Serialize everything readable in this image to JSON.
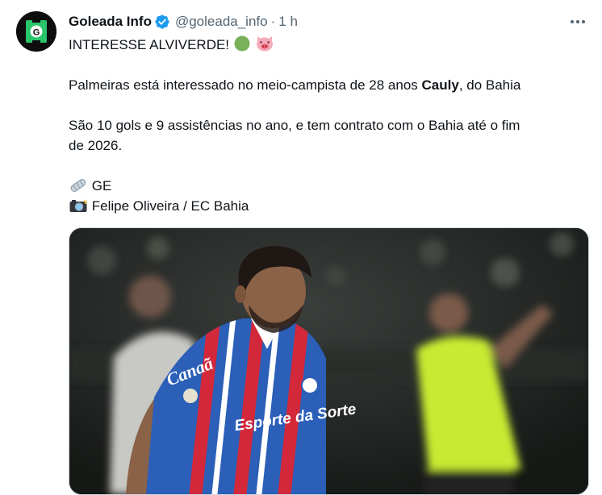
{
  "author": {
    "name": "Goleada Info",
    "handle": "@goleada_info",
    "separator": "·",
    "time": "1 h",
    "avatar_icon": "goleada-g-logo-icon",
    "verified_icon": "verified-badge-icon"
  },
  "tweet": {
    "headline": "INTERESSE ALVIVERDE!",
    "headline_emojis": [
      "green-circle-icon",
      "pig-face-icon"
    ],
    "line1_pre": "Palmeiras está interessado no meio-campista de 28 anos ",
    "line1_bold": "Cauly",
    "line1_post": ", do Bahia",
    "line2a": "São 10 gols e 9 assistências no ano, e tem contrato com o Bahia até o fim",
    "line2b": "de 2026.",
    "source_icon": "newspaper-roll-icon",
    "source": "GE",
    "photo_icon": "camera-flash-icon",
    "photo_credit": "Felipe Oliveira / EC Bahia"
  },
  "media": {
    "kind": "photo",
    "subject": "soccer-player",
    "shirt_sponsor_1": "Canaã",
    "shirt_sponsor_2": "Esporte da Sorte"
  },
  "colors": {
    "verified": "#1d9bf0",
    "secondary_text": "#536471",
    "avatar_green": "#29c56a",
    "bahia_blue": "#2b5fb8",
    "bahia_red": "#d3283a",
    "referee_yellow": "#c9ea30"
  }
}
